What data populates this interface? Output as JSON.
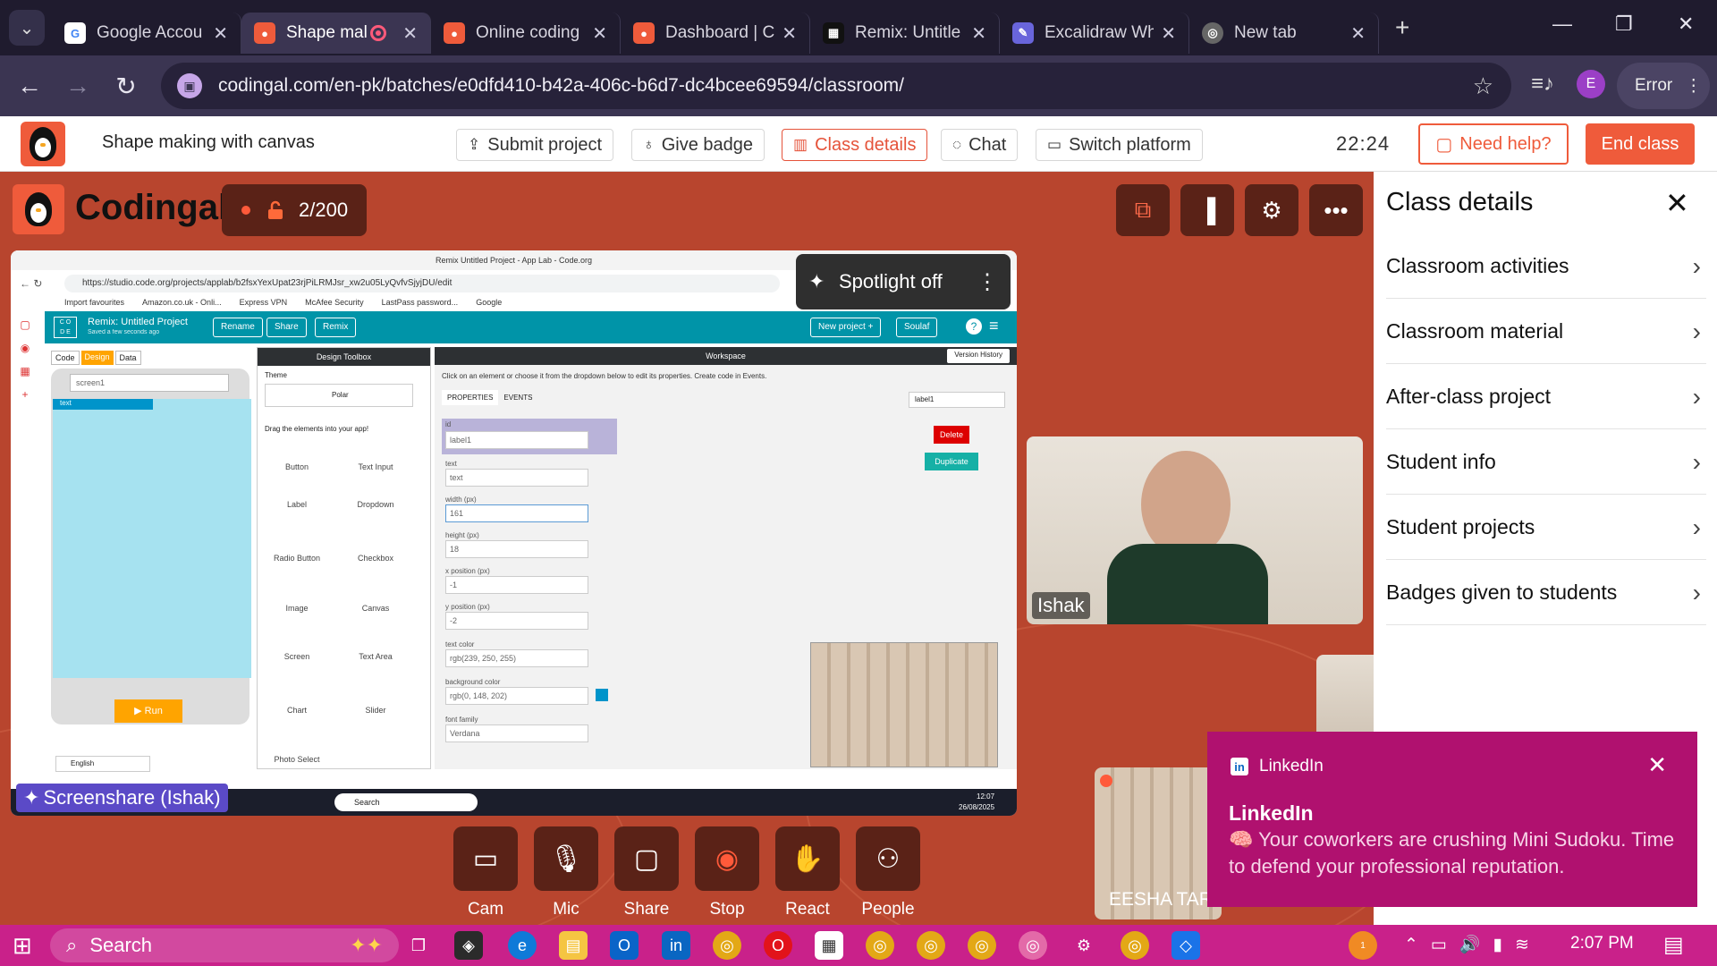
{
  "browser": {
    "tabs": [
      {
        "title": "Google Accou",
        "icon": "google-icon",
        "active": false
      },
      {
        "title": "Shape mal",
        "icon": "codingal-icon",
        "active": true
      },
      {
        "title": "Online coding",
        "icon": "codingal-icon",
        "active": false
      },
      {
        "title": "Dashboard | C",
        "icon": "codingal-icon",
        "active": false
      },
      {
        "title": "Remix: Untitle",
        "icon": "code-org-icon",
        "active": false
      },
      {
        "title": "Excalidraw Wh",
        "icon": "excalidraw-icon",
        "active": false
      },
      {
        "title": "New tab",
        "icon": "chrome-icon",
        "active": false
      }
    ],
    "url": "codingal.com/en-pk/batches/e0dfd410-b42a-406c-b6d7-dc4bcee69594/classroom/",
    "profile_initial": "E",
    "error_label": "Error"
  },
  "header": {
    "lesson_title": "Shape making with canvas",
    "buttons": {
      "submit_project": "Submit project",
      "give_badge": "Give badge",
      "class_details": "Class details",
      "chat": "Chat",
      "switch_platform": "Switch platform"
    },
    "clock": "22:24",
    "need_help": "Need help?",
    "end_class": "End class"
  },
  "stage": {
    "brand": "Codingal",
    "counter": "2/200",
    "spotlight": "Spotlight off",
    "screenshare_label": "Screenshare (Ishak)",
    "controls": {
      "cam": "Cam",
      "mic": "Mic",
      "share": "Share",
      "stop": "Stop",
      "react": "React",
      "people": "People"
    },
    "participants": {
      "ishak": "Ishak",
      "eesha": "EESHA TAR"
    }
  },
  "shared_screen": {
    "window_title": "Remix Untitled Project - App Lab - Code.org",
    "url": "https://studio.code.org/projects/applab/b2fsxYexUpat23rjPiLRMJsr_xw2u05LyQvfvSjyjDU/edit",
    "bookmarks": [
      "Import favourites",
      "Amazon.co.uk - Onli...",
      "Express VPN",
      "McAfee Security",
      "LastPass password...",
      "Google"
    ],
    "project_title": "Remix: Untitled Project",
    "saved": "Saved a few seconds ago",
    "buttons": {
      "rename": "Rename",
      "share": "Share",
      "remix": "Remix",
      "new_project": "New project +",
      "user": "Soulaf"
    },
    "mode_tabs": [
      "Code",
      "Design",
      "Data"
    ],
    "screen_select": "screen1",
    "text_element": "text",
    "run": "Run",
    "language": "English",
    "toolbox_title": "Design Toolbox",
    "theme_label": "Theme",
    "theme_value": "Polar",
    "drag_hint": "Drag the elements into your app!",
    "elements": [
      "Button",
      "Text Input",
      "Label",
      "Dropdown",
      "Radio Button",
      "Checkbox",
      "Image",
      "Canvas",
      "Screen",
      "Text Area",
      "Chart",
      "Slider",
      "Photo Select"
    ],
    "workspace_title": "Workspace",
    "version_history": "Version History",
    "hint": "Click on an element or choose it from the dropdown below to edit its properties. Create code in Events.",
    "prop_tabs": [
      "PROPERTIES",
      "EVENTS"
    ],
    "element_select": "label1",
    "delete": "Delete",
    "duplicate": "Duplicate",
    "props": [
      {
        "label": "id",
        "value": "label1"
      },
      {
        "label": "text",
        "value": "text"
      },
      {
        "label": "width (px)",
        "value": "161"
      },
      {
        "label": "height (px)",
        "value": "18"
      },
      {
        "label": "x position (px)",
        "value": "-1"
      },
      {
        "label": "y position (px)",
        "value": "-2"
      },
      {
        "label": "text color",
        "value": "rgb(239, 250, 255)"
      },
      {
        "label": "background color",
        "value": "rgb(0, 148, 202)"
      },
      {
        "label": "font family",
        "value": "Verdana"
      }
    ],
    "taskbar_search": "Search",
    "taskbar_time": "12:07",
    "taskbar_date": "26/08/2025"
  },
  "panel": {
    "title": "Class details",
    "items": [
      "Classroom activities",
      "Classroom material",
      "After-class project",
      "Student info",
      "Student projects",
      "Badges given to students"
    ]
  },
  "toast": {
    "app": "LinkedIn",
    "title": "LinkedIn",
    "body": "🧠 Your coworkers are crushing Mini Sudoku. Time to defend your professional reputation."
  },
  "taskbar": {
    "search": "Search",
    "time": "2:07 PM",
    "notification_count": "1"
  },
  "colors": {
    "brand": "#ef5b3b",
    "stage": "#b8452e",
    "toast": "#b0116f",
    "taskbar": "#c9218a",
    "applab_teal": "#0094a8"
  }
}
